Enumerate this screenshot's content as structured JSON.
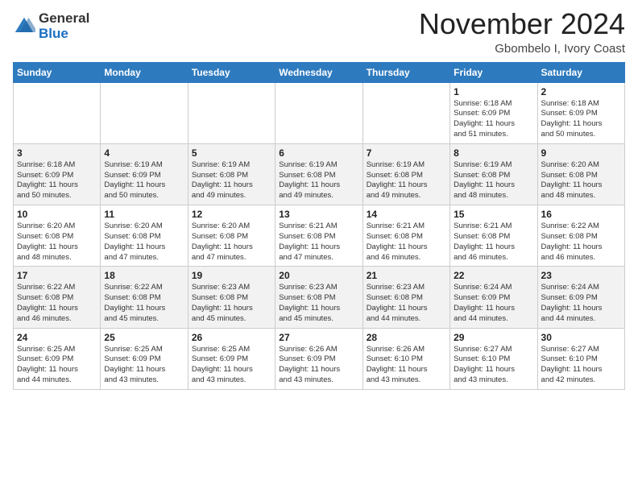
{
  "header": {
    "logo_line1": "General",
    "logo_line2": "Blue",
    "month": "November 2024",
    "location": "Gbombelo I, Ivory Coast"
  },
  "weekdays": [
    "Sunday",
    "Monday",
    "Tuesday",
    "Wednesday",
    "Thursday",
    "Friday",
    "Saturday"
  ],
  "weeks": [
    [
      {
        "day": "",
        "info": ""
      },
      {
        "day": "",
        "info": ""
      },
      {
        "day": "",
        "info": ""
      },
      {
        "day": "",
        "info": ""
      },
      {
        "day": "",
        "info": ""
      },
      {
        "day": "1",
        "info": "Sunrise: 6:18 AM\nSunset: 6:09 PM\nDaylight: 11 hours\nand 51 minutes."
      },
      {
        "day": "2",
        "info": "Sunrise: 6:18 AM\nSunset: 6:09 PM\nDaylight: 11 hours\nand 50 minutes."
      }
    ],
    [
      {
        "day": "3",
        "info": "Sunrise: 6:18 AM\nSunset: 6:09 PM\nDaylight: 11 hours\nand 50 minutes."
      },
      {
        "day": "4",
        "info": "Sunrise: 6:19 AM\nSunset: 6:09 PM\nDaylight: 11 hours\nand 50 minutes."
      },
      {
        "day": "5",
        "info": "Sunrise: 6:19 AM\nSunset: 6:08 PM\nDaylight: 11 hours\nand 49 minutes."
      },
      {
        "day": "6",
        "info": "Sunrise: 6:19 AM\nSunset: 6:08 PM\nDaylight: 11 hours\nand 49 minutes."
      },
      {
        "day": "7",
        "info": "Sunrise: 6:19 AM\nSunset: 6:08 PM\nDaylight: 11 hours\nand 49 minutes."
      },
      {
        "day": "8",
        "info": "Sunrise: 6:19 AM\nSunset: 6:08 PM\nDaylight: 11 hours\nand 48 minutes."
      },
      {
        "day": "9",
        "info": "Sunrise: 6:20 AM\nSunset: 6:08 PM\nDaylight: 11 hours\nand 48 minutes."
      }
    ],
    [
      {
        "day": "10",
        "info": "Sunrise: 6:20 AM\nSunset: 6:08 PM\nDaylight: 11 hours\nand 48 minutes."
      },
      {
        "day": "11",
        "info": "Sunrise: 6:20 AM\nSunset: 6:08 PM\nDaylight: 11 hours\nand 47 minutes."
      },
      {
        "day": "12",
        "info": "Sunrise: 6:20 AM\nSunset: 6:08 PM\nDaylight: 11 hours\nand 47 minutes."
      },
      {
        "day": "13",
        "info": "Sunrise: 6:21 AM\nSunset: 6:08 PM\nDaylight: 11 hours\nand 47 minutes."
      },
      {
        "day": "14",
        "info": "Sunrise: 6:21 AM\nSunset: 6:08 PM\nDaylight: 11 hours\nand 46 minutes."
      },
      {
        "day": "15",
        "info": "Sunrise: 6:21 AM\nSunset: 6:08 PM\nDaylight: 11 hours\nand 46 minutes."
      },
      {
        "day": "16",
        "info": "Sunrise: 6:22 AM\nSunset: 6:08 PM\nDaylight: 11 hours\nand 46 minutes."
      }
    ],
    [
      {
        "day": "17",
        "info": "Sunrise: 6:22 AM\nSunset: 6:08 PM\nDaylight: 11 hours\nand 46 minutes."
      },
      {
        "day": "18",
        "info": "Sunrise: 6:22 AM\nSunset: 6:08 PM\nDaylight: 11 hours\nand 45 minutes."
      },
      {
        "day": "19",
        "info": "Sunrise: 6:23 AM\nSunset: 6:08 PM\nDaylight: 11 hours\nand 45 minutes."
      },
      {
        "day": "20",
        "info": "Sunrise: 6:23 AM\nSunset: 6:08 PM\nDaylight: 11 hours\nand 45 minutes."
      },
      {
        "day": "21",
        "info": "Sunrise: 6:23 AM\nSunset: 6:08 PM\nDaylight: 11 hours\nand 44 minutes."
      },
      {
        "day": "22",
        "info": "Sunrise: 6:24 AM\nSunset: 6:09 PM\nDaylight: 11 hours\nand 44 minutes."
      },
      {
        "day": "23",
        "info": "Sunrise: 6:24 AM\nSunset: 6:09 PM\nDaylight: 11 hours\nand 44 minutes."
      }
    ],
    [
      {
        "day": "24",
        "info": "Sunrise: 6:25 AM\nSunset: 6:09 PM\nDaylight: 11 hours\nand 44 minutes."
      },
      {
        "day": "25",
        "info": "Sunrise: 6:25 AM\nSunset: 6:09 PM\nDaylight: 11 hours\nand 43 minutes."
      },
      {
        "day": "26",
        "info": "Sunrise: 6:25 AM\nSunset: 6:09 PM\nDaylight: 11 hours\nand 43 minutes."
      },
      {
        "day": "27",
        "info": "Sunrise: 6:26 AM\nSunset: 6:09 PM\nDaylight: 11 hours\nand 43 minutes."
      },
      {
        "day": "28",
        "info": "Sunrise: 6:26 AM\nSunset: 6:10 PM\nDaylight: 11 hours\nand 43 minutes."
      },
      {
        "day": "29",
        "info": "Sunrise: 6:27 AM\nSunset: 6:10 PM\nDaylight: 11 hours\nand 43 minutes."
      },
      {
        "day": "30",
        "info": "Sunrise: 6:27 AM\nSunset: 6:10 PM\nDaylight: 11 hours\nand 42 minutes."
      }
    ]
  ]
}
